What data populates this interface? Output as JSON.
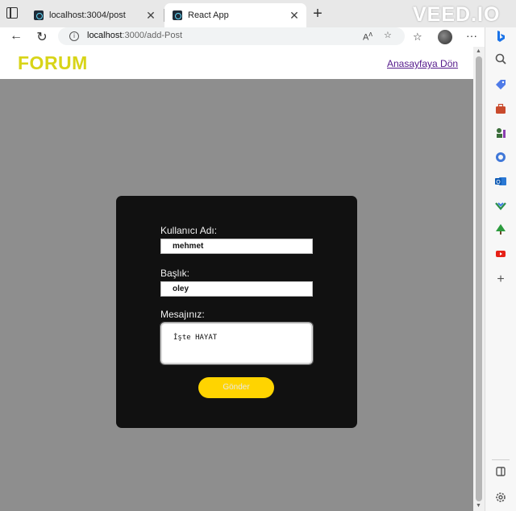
{
  "browser": {
    "tabs": [
      {
        "title": "localhost:3004/post",
        "active": false
      },
      {
        "title": "React App",
        "active": true
      }
    ],
    "address": {
      "host": "localhost",
      "path": ":3000/add-Post"
    },
    "watermark": "VEED.IO"
  },
  "site": {
    "logo": "FORUM",
    "home_link": "Anasayfaya Dön"
  },
  "form": {
    "username_label": "Kullanıcı Adı:",
    "username_value": "mehmet",
    "title_label": "Başlık:",
    "title_value": "oley",
    "message_label": "Mesajınız:",
    "message_value": "İşte HAYAT",
    "submit_label": "Gönder"
  },
  "colors": {
    "logo": "#d8d418",
    "page_background": "#8e8e8e",
    "card_background": "#111111",
    "submit_button": "#ffd400",
    "link": "#551a8b"
  },
  "sidebar_icons": [
    "search-icon",
    "tag-icon",
    "briefcase-icon",
    "chess-icon",
    "circle-icon",
    "outlook-icon",
    "tree-icon",
    "youtube-icon",
    "plus-icon",
    "split-screen-icon",
    "settings-icon"
  ]
}
